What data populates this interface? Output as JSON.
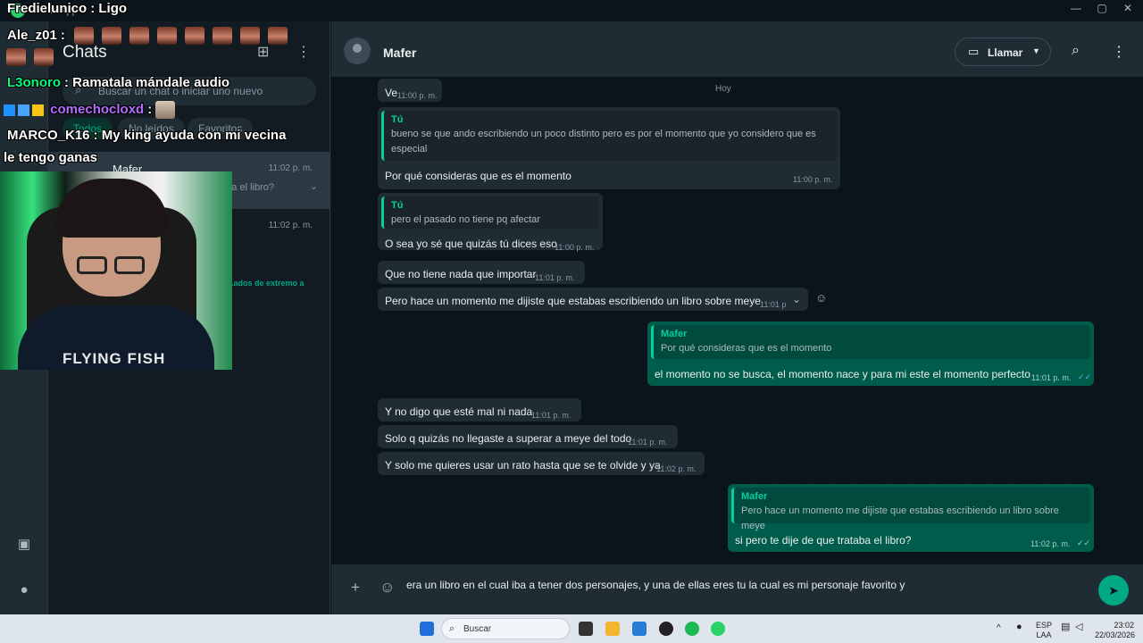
{
  "window": {
    "app_name": "WhatsApp",
    "minimize": "—",
    "maximize": "▢",
    "close": "✕"
  },
  "sidebar": {
    "title": "Chats",
    "new_chat_icon": "new-chat-icon",
    "menu_icon": "kebab-menu-icon",
    "search": {
      "placeholder": "Buscar un chat o iniciar uno nuevo"
    },
    "filters": [
      "Todos",
      "No leídos",
      "Favoritos"
    ],
    "chats": [
      {
        "name": "Mafer",
        "time": "11:02 p. m.",
        "preview": "si pero te dije de que trataba el libro?"
      },
      {
        "name": "",
        "time": "11:02 p. m.",
        "preview": ""
      }
    ],
    "snippet": "...ados de extremo a"
  },
  "overlay_chat": [
    {
      "user": "Fredielunico",
      "color": "#ffffff",
      "text": "Ligo"
    },
    {
      "user": "Ale_z01",
      "color": "#ffffff",
      "text": ""
    },
    {
      "user": "L3onoro",
      "color": "#00ff7f",
      "text": "Ramatala mándale audio"
    },
    {
      "user": "comechocloxd",
      "color": "#b36cff",
      "text": ""
    },
    {
      "user": "MARCO_K16",
      "color": "#ffffff",
      "text": "My king ayuda con mi vecina"
    },
    {
      "user": "",
      "color": "#ffffff",
      "text": "le tengo ganas"
    }
  ],
  "conversation": {
    "contact": "Mafer",
    "call_label": "Llamar",
    "day_divider": "Hoy",
    "messages": {
      "m0": {
        "text": "Ve",
        "time": "11:00 p. m."
      },
      "m1": {
        "quote_author": "Tú",
        "quote_line1": "bueno se que ando escribiendo un poco distinto pero es por el momento que yo considero que es",
        "quote_line2": "especial",
        "text": "Por qué consideras que es el momento",
        "time": "11:00 p. m."
      },
      "m2": {
        "quote_author": "Tú",
        "quote_text": "pero el pasado no tiene pq afectar",
        "text": "O sea yo sé que quizás tú dices eso",
        "time": "11:00 p. m."
      },
      "m3": {
        "text": "Que no tiene nada que importar",
        "time": "11:01 p. m."
      },
      "m4": {
        "text": "Pero hace un momento me dijiste que estabas escribiendo un libro sobre meye",
        "time": "11:01 p. m."
      },
      "m5": {
        "quote_author": "Mafer",
        "quote_text": "Por qué consideras que es el momento",
        "text": "el momento no se busca, el momento nace y para mi este el momento perfecto",
        "time": "11:01 p. m."
      },
      "m6": {
        "text": "Y no digo que esté mal ni nada",
        "time": "11:01 p. m."
      },
      "m7": {
        "text": "Solo q quizás no llegaste a superar a meye del todo",
        "time": "11:01 p. m."
      },
      "m8": {
        "text": "Y solo me quieres usar un rato hasta que se te olvide y ya",
        "time": "11:02 p. m."
      },
      "m9": {
        "quote_author": "Mafer",
        "quote_text": "Pero hace un momento me dijiste que estabas escribiendo un libro sobre meye",
        "text": "si pero te dije de que trataba el libro?",
        "time": "11:02 p. m."
      }
    },
    "composer_value": "era un libro en el cual iba a tener dos personajes, y una de ellas eres tu la cual es mi personaje favorito y"
  },
  "webcam": {
    "shirt_text": "FLYING FISH"
  },
  "taskbar": {
    "search_label": "Buscar",
    "lang_line1": "ESP",
    "lang_line2": "LAA",
    "clock_time": "23:02",
    "clock_date": "22/03/2026"
  },
  "colors": {
    "accent": "#00a884",
    "incoming": "#202c33",
    "outgoing": "#005c4b",
    "background": "#0b141a"
  }
}
